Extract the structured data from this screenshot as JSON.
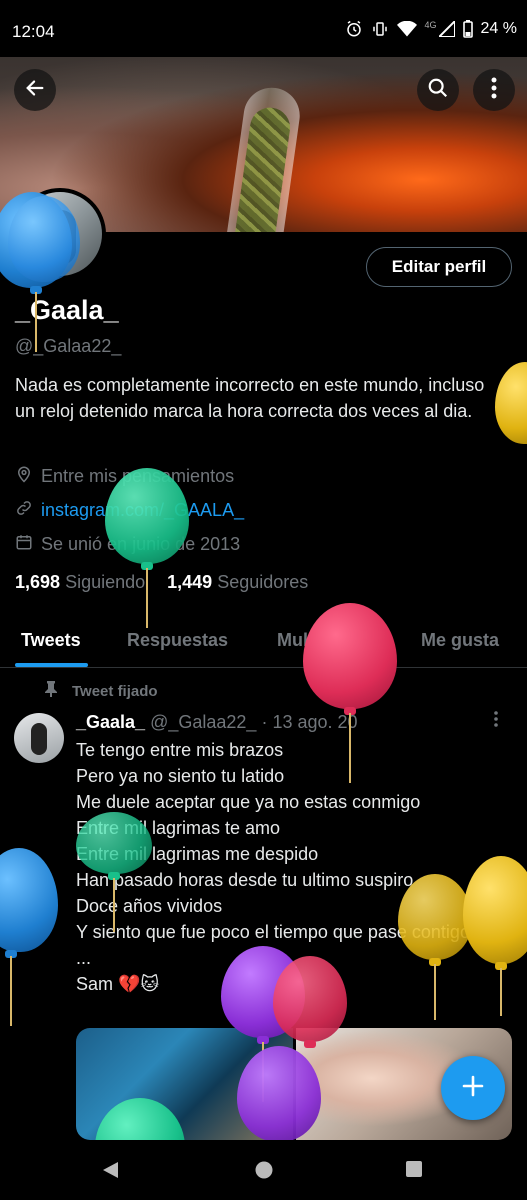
{
  "status_bar": {
    "time": "12:04",
    "battery": "24 %",
    "network": "4G"
  },
  "profile": {
    "edit_button": "Editar perfil",
    "name": "_Gaala_",
    "handle": "@_Galaa22_",
    "bio": "Nada es completamente incorrecto en este mundo, incluso un reloj detenido marca la hora correcta dos veces al dia.",
    "location": "Entre mis pensamientos",
    "website": "instagram.com/_GAALA_",
    "joined": "Se unió en junio de 2013",
    "following_count": "1,698",
    "following_label": "Siguiendo",
    "followers_count": "1,449",
    "followers_label": "Seguidores"
  },
  "tabs": [
    "Tweets",
    "Respuestas",
    "Multimedia",
    "Me gusta"
  ],
  "pinned_label": "Tweet fijado",
  "tweet": {
    "name": "_Gaala_",
    "handle": "@_Galaa22_",
    "date": "· 13 ago. 20",
    "text": "Te tengo entre mis brazos\nPero ya no siento tu latido\nMe duele aceptar que ya no estas conmigo\nEntre mil lagrimas te amo\nEntre mil lagrimas me despido\nHan pasado horas desde tu ultimo suspiro\nDoce años vividos\nY siento que fue poco el tiempo que pase contigo\n...\nSam 💔🐱"
  },
  "icons": {
    "back": "back-arrow-icon",
    "search": "search-icon",
    "more": "more-vertical-icon",
    "location": "location-pin-icon",
    "link": "link-icon",
    "calendar": "calendar-icon",
    "pin": "pin-icon",
    "compose": "plus-icon"
  },
  "colors": {
    "accent": "#1d9bf0",
    "muted": "#71767b",
    "background": "#000000"
  }
}
